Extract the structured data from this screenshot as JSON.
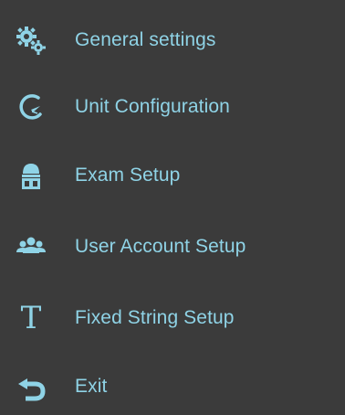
{
  "menu": {
    "accent_color": "#8fd3e6",
    "background_color": "#3b3b3b",
    "items": [
      {
        "label": "General settings",
        "icon": "gears-icon"
      },
      {
        "label": "Unit Configuration",
        "icon": "gauge-icon"
      },
      {
        "label": "Exam Setup",
        "icon": "exam-bed-icon"
      },
      {
        "label": "User Account Setup",
        "icon": "users-icon"
      },
      {
        "label": "Fixed String Setup",
        "icon": "text-t-icon",
        "glyph": "T"
      },
      {
        "label": "Exit",
        "icon": "exit-arrow-icon"
      }
    ]
  }
}
